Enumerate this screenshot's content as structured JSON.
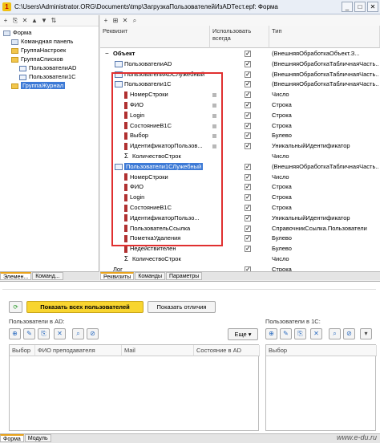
{
  "window": {
    "title": "C:\\Users\\Administrator.ORG\\Documents\\tmp\\ЗагрузкаПользователейИзADТест.epf: Форма",
    "icon": "1c-app-icon"
  },
  "left_tree": {
    "items": [
      {
        "label": "Форма",
        "level": 0,
        "kind": "form"
      },
      {
        "label": "Командная панель",
        "level": 1,
        "kind": "panel"
      },
      {
        "label": "ГруппаНастроек",
        "level": 1,
        "kind": "folder"
      },
      {
        "label": "ГруппаСписков",
        "level": 1,
        "kind": "folder"
      },
      {
        "label": "ПользователиAD",
        "level": 2,
        "kind": "table"
      },
      {
        "label": "Пользователи1С",
        "level": 2,
        "kind": "table"
      },
      {
        "label": "ГруппаЖурнал",
        "level": 1,
        "kind": "folder",
        "selected": true
      }
    ],
    "tabs": [
      "Элемен...",
      "Команд..."
    ]
  },
  "attr_grid": {
    "headers": {
      "attr": "Реквизит",
      "always": "Использовать всегда",
      "type": "Тип"
    },
    "rows": [
      {
        "label": "Объект",
        "level": 0,
        "icon": "object",
        "bold": true,
        "always": true,
        "type": "(ВнешняяОбработкаОбъект.З..."
      },
      {
        "label": "ПользователиAD",
        "level": 1,
        "icon": "table",
        "always": true,
        "type": "(ВнешняяОбработкаТабличнаяЧасть..."
      },
      {
        "label": "ПользователиADСлужебный",
        "level": 1,
        "icon": "table",
        "always": true,
        "type": "(ВнешняяОбработкаТабличнаяЧасть..."
      },
      {
        "label": "Пользователи1С",
        "level": 1,
        "icon": "table",
        "always": true,
        "type": "(ВнешняяОбработкаТабличнаяЧасть..."
      },
      {
        "label": "НомерСтроки",
        "level": 2,
        "icon": "attr",
        "always": true,
        "type": "Число"
      },
      {
        "label": "ФИО",
        "level": 2,
        "icon": "attr",
        "always": true,
        "type": "Строка"
      },
      {
        "label": "Login",
        "level": 2,
        "icon": "attr",
        "always": true,
        "type": "Строка"
      },
      {
        "label": "СостояниеВ1С",
        "level": 2,
        "icon": "attr",
        "always": true,
        "type": "Строка"
      },
      {
        "label": "Выбор",
        "level": 2,
        "icon": "attr",
        "always": true,
        "type": "Булево"
      },
      {
        "label": "ИдентификаторПользов...",
        "level": 2,
        "icon": "attr",
        "always": true,
        "type": "УникальныйИдентификатор"
      },
      {
        "label": "КоличествоСтрок",
        "level": 2,
        "icon": "sum",
        "always": false,
        "type": "Число"
      },
      {
        "label": "Пользователи1СЛужебный",
        "level": 1,
        "icon": "table",
        "selected": true,
        "always": true,
        "type": "(ВнешняяОбработкаТабличнаяЧасть..."
      },
      {
        "label": "НомерСтроки",
        "level": 2,
        "icon": "attr",
        "always": true,
        "type": "Число"
      },
      {
        "label": "ФИО",
        "level": 2,
        "icon": "attr",
        "always": true,
        "type": "Строка"
      },
      {
        "label": "Login",
        "level": 2,
        "icon": "attr",
        "always": true,
        "type": "Строка"
      },
      {
        "label": "СостояниеВ1С",
        "level": 2,
        "icon": "attr",
        "always": true,
        "type": "Строка"
      },
      {
        "label": "ИдентификаторПользо...",
        "level": 2,
        "icon": "attr",
        "always": true,
        "type": "УникальныйИдентификатор"
      },
      {
        "label": "ПользовательСсылка",
        "level": 2,
        "icon": "attr",
        "always": true,
        "type": "СправочникСсылка.Пользователи"
      },
      {
        "label": "ПометкаУдаления",
        "level": 2,
        "icon": "attr",
        "always": true,
        "type": "Булево"
      },
      {
        "label": "Недействителен",
        "level": 2,
        "icon": "attr",
        "always": true,
        "type": "Булево"
      },
      {
        "label": "КоличествоСтрок",
        "level": 2,
        "icon": "sum",
        "always": false,
        "type": "Число"
      },
      {
        "label": "Лог",
        "level": 0,
        "icon": "none",
        "always": true,
        "type": "Строка"
      }
    ],
    "tabs": [
      "Реквизиты",
      "Команды",
      "Параметры"
    ]
  },
  "preview": {
    "refresh_icon": "refresh-icon",
    "show_all_button": "Показать всех пользователей",
    "show_diff_button": "Показать отличия",
    "ad_label": "Пользователи в AD:",
    "c1_label": "Пользователи в 1С:",
    "more_button": "Еще",
    "ad_columns": [
      "Выбор",
      "ФИО преподавателя",
      "Mail",
      "Состояние в AD"
    ],
    "c1_columns": [
      "Выбор"
    ]
  },
  "bottom_tabs": [
    "Форма",
    "Модуль"
  ],
  "watermark": "www.e-du.ru",
  "colors": {
    "accent": "#f8d530",
    "selection": "#3d7ad6",
    "highlight_box": "#e03030"
  }
}
